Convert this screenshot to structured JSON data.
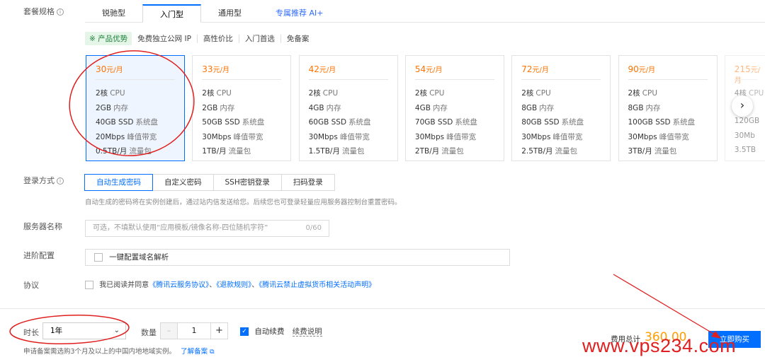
{
  "labels": {
    "plan": "套餐规格",
    "login": "登录方式",
    "server_name": "服务器名称",
    "advanced": "进阶配置",
    "agreement": "协议",
    "duration": "时长",
    "quantity": "数量"
  },
  "tabs": [
    {
      "label": "锐驰型"
    },
    {
      "label": "入门型",
      "active": true
    },
    {
      "label": "通用型"
    },
    {
      "label": "专属推荐 AI+"
    }
  ],
  "advantages": {
    "badge": "※ 产品优势",
    "items": [
      "免费独立公网 IP",
      "高性价比",
      "入门首选",
      "免备案"
    ]
  },
  "cards": [
    {
      "price": "30",
      "unit": "元/月",
      "cpu": "2核",
      "cpu_u": "CPU",
      "mem": "2GB",
      "mem_u": "内存",
      "disk": "40GB SSD",
      "disk_u": "系统盘",
      "bw": "20Mbps",
      "bw_u": "峰值带宽",
      "traffic": "0.5TB/月",
      "traffic_u": "流量包"
    },
    {
      "price": "33",
      "unit": "元/月",
      "cpu": "2核",
      "cpu_u": "CPU",
      "mem": "2GB",
      "mem_u": "内存",
      "disk": "50GB SSD",
      "disk_u": "系统盘",
      "bw": "30Mbps",
      "bw_u": "峰值带宽",
      "traffic": "1TB/月",
      "traffic_u": "流量包"
    },
    {
      "price": "42",
      "unit": "元/月",
      "cpu": "2核",
      "cpu_u": "CPU",
      "mem": "4GB",
      "mem_u": "内存",
      "disk": "60GB SSD",
      "disk_u": "系统盘",
      "bw": "30Mbps",
      "bw_u": "峰值带宽",
      "traffic": "1.5TB/月",
      "traffic_u": "流量包"
    },
    {
      "price": "54",
      "unit": "元/月",
      "cpu": "2核",
      "cpu_u": "CPU",
      "mem": "4GB",
      "mem_u": "内存",
      "disk": "70GB SSD",
      "disk_u": "系统盘",
      "bw": "30Mbps",
      "bw_u": "峰值带宽",
      "traffic": "2TB/月",
      "traffic_u": "流量包"
    },
    {
      "price": "72",
      "unit": "元/月",
      "cpu": "2核",
      "cpu_u": "CPU",
      "mem": "8GB",
      "mem_u": "内存",
      "disk": "80GB SSD",
      "disk_u": "系统盘",
      "bw": "30Mbps",
      "bw_u": "峰值带宽",
      "traffic": "2.5TB/月",
      "traffic_u": "流量包"
    },
    {
      "price": "90",
      "unit": "元/月",
      "cpu": "2核",
      "cpu_u": "CPU",
      "mem": "8GB",
      "mem_u": "内存",
      "disk": "100GB SSD",
      "disk_u": "系统盘",
      "bw": "30Mbps",
      "bw_u": "峰值带宽",
      "traffic": "3TB/月",
      "traffic_u": "流量包"
    },
    {
      "price": "215",
      "unit": "元/月",
      "cpu": "4核",
      "cpu_u": "CPU",
      "mem": "",
      "mem_u": "",
      "disk": "120GB",
      "disk_u": "",
      "bw": "30Mb",
      "bw_u": "",
      "traffic": "3.5TB",
      "traffic_u": ""
    }
  ],
  "login": {
    "options": [
      {
        "label": "自动生成密码",
        "active": true
      },
      {
        "label": "自定义密码"
      },
      {
        "label": "SSH密钥登录"
      },
      {
        "label": "扫码登录"
      }
    ],
    "hint": "自动生成的密码将在实例创建后，通过站内信发送给您。后续您也可登录轻量应用服务器控制台重置密码。"
  },
  "server_name": {
    "placeholder": "可选，不填默认使用“应用模板/镜像名称-四位随机字符”",
    "counter": "0/60"
  },
  "advanced": {
    "option": "一键配置域名解析"
  },
  "agreement": {
    "prefix": "我已阅读并同意",
    "link1": "《腾讯云服务协议》",
    "sep1": "、",
    "link2": "《退款规则》",
    "sep2": "、",
    "link3": "《腾讯云禁止虚拟货币相关活动声明》"
  },
  "bottom": {
    "duration_value": "1年",
    "quantity_value": "1",
    "auto_renew": "自动续费",
    "fee_link": "续费说明",
    "total_label": "费用总计",
    "total_value": "360.00",
    "buy": "立即购买",
    "notice": "申请备案需选购3个月及以上的中国内地地域实例。",
    "notice_link": "了解备案"
  },
  "watermark": "www.vps234.com",
  "colors": {
    "accent": "#006eff",
    "price": "#ff7200",
    "annotation": "#e02020"
  }
}
